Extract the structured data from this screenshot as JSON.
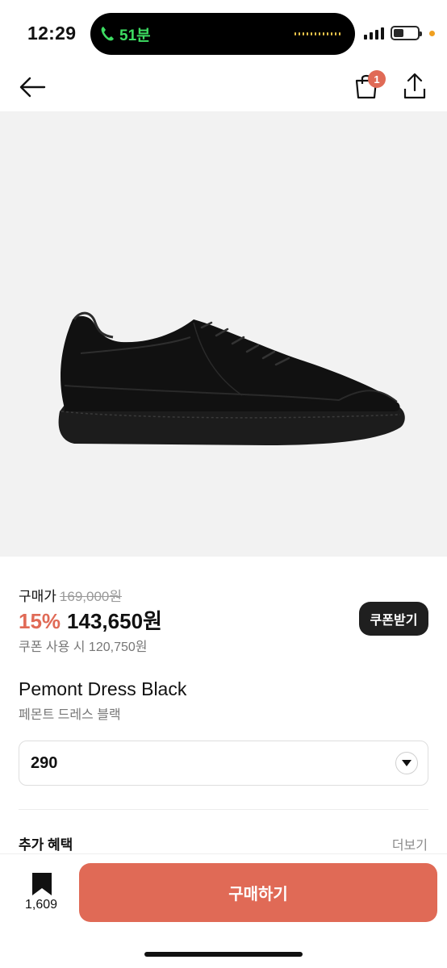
{
  "status_bar": {
    "time": "12:29",
    "call_duration": "51분"
  },
  "nav": {
    "back_icon": "arrow-left-icon",
    "bag_icon": "shopping-bag-icon",
    "bag_badge": "1",
    "share_icon": "share-icon"
  },
  "product": {
    "image_alt": "black leather sneaker",
    "price_label": "구매가",
    "original_price": "169,000원",
    "discount": "15%",
    "sale_price": "143,650원",
    "coupon_price_text": "쿠폰 사용 시 120,750원",
    "coupon_button": "쿠폰받기",
    "name_en": "Pemont Dress Black",
    "name_ko": "페몬트 드레스 블랙"
  },
  "options": {
    "size_selected": "290"
  },
  "benefits": {
    "title": "추가 혜택",
    "more": "더보기"
  },
  "bottom_bar": {
    "bookmark_count": "1,609",
    "buy_button": "구매하기"
  },
  "colors": {
    "accent": "#e06a56",
    "dark_button": "#1f1f1f",
    "image_bg": "#f2f2f2"
  }
}
